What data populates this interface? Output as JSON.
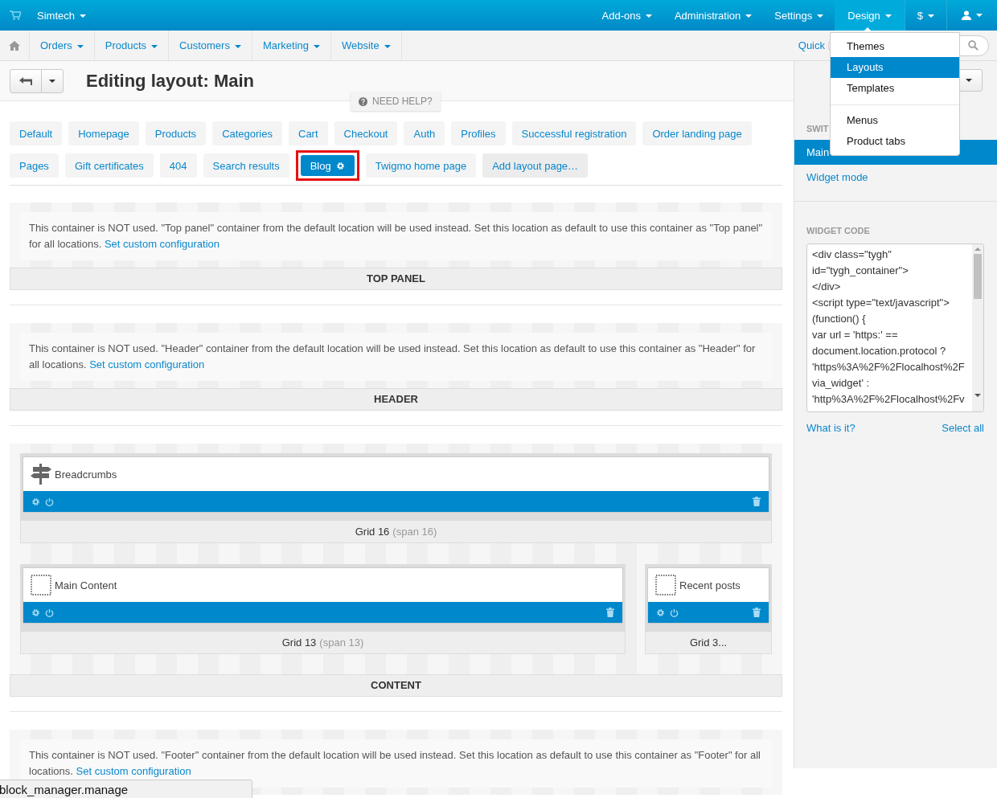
{
  "top_bar": {
    "store": "Simtech",
    "menus": [
      {
        "label": "Add-ons",
        "kind": "text",
        "selected": false
      },
      {
        "label": "Administration",
        "kind": "text",
        "selected": false
      },
      {
        "label": "Settings",
        "kind": "text",
        "selected": false
      },
      {
        "label": "Design",
        "kind": "text",
        "selected": true
      },
      {
        "label": "$",
        "kind": "boxed",
        "selected": false
      },
      {
        "kind": "user",
        "selected": false
      }
    ]
  },
  "nav": {
    "items": [
      "Orders",
      "Products",
      "Customers",
      "Marketing",
      "Website"
    ],
    "quick": "Quick"
  },
  "design_menu": {
    "groups": [
      [
        {
          "label": "Themes",
          "selected": false
        },
        {
          "label": "Layouts",
          "selected": true
        },
        {
          "label": "Templates",
          "selected": false
        }
      ],
      [
        {
          "label": "Menus",
          "selected": false
        },
        {
          "label": "Product tabs",
          "selected": false
        }
      ]
    ]
  },
  "header": {
    "title": "Editing layout: Main",
    "help": "NEED HELP?"
  },
  "layout_tabs": [
    [
      {
        "label": "Default",
        "kind": "page",
        "selected": false,
        "highlighted": false
      },
      {
        "label": "Homepage",
        "kind": "page",
        "selected": false,
        "highlighted": false
      },
      {
        "label": "Products",
        "kind": "page",
        "selected": false,
        "highlighted": false
      },
      {
        "label": "Categories",
        "kind": "page",
        "selected": false,
        "highlighted": false
      },
      {
        "label": "Cart",
        "kind": "page",
        "selected": false,
        "highlighted": false
      },
      {
        "label": "Checkout",
        "kind": "page",
        "selected": false,
        "highlighted": false
      },
      {
        "label": "Auth",
        "kind": "page",
        "selected": false,
        "highlighted": false
      },
      {
        "label": "Profiles",
        "kind": "page",
        "selected": false,
        "highlighted": false
      },
      {
        "label": "Successful registration",
        "kind": "page",
        "selected": false,
        "highlighted": false
      },
      {
        "label": "Order landing page",
        "kind": "page",
        "selected": false,
        "highlighted": false
      }
    ],
    [
      {
        "label": "Pages",
        "kind": "page",
        "selected": false,
        "highlighted": false
      },
      {
        "label": "Gift certificates",
        "kind": "page",
        "selected": false,
        "highlighted": false
      },
      {
        "label": "404",
        "kind": "page",
        "selected": false,
        "highlighted": false
      },
      {
        "label": "Search results",
        "kind": "page",
        "selected": false,
        "highlighted": false
      },
      {
        "label": "Blog",
        "kind": "page",
        "selected": true,
        "highlighted": true
      },
      {
        "label": "Twigmo home page",
        "kind": "page",
        "selected": false,
        "highlighted": false
      },
      {
        "label": "Add layout page…",
        "kind": "add",
        "selected": false,
        "highlighted": false
      }
    ]
  ],
  "containers": [
    {
      "title": "TOP PANEL",
      "used": false,
      "notice": "This container is NOT used. \"Top panel\" container from the default location will be used instead. Set this location as default to use this container as \"Top panel\" for all locations.",
      "link": "Set custom configuration"
    },
    {
      "title": "HEADER",
      "used": false,
      "notice": "This container is NOT used. \"Header\" container from the default location will be used instead. Set this location as default to use this container as \"Header\" for all locations.",
      "link": "Set custom configuration"
    },
    {
      "title": "CONTENT",
      "used": true,
      "grid_rows": [
        [
          {
            "title": "Grid 16",
            "span": "(span 16)",
            "blocks": [
              {
                "name": "Breadcrumbs",
                "kind": "signpost"
              }
            ]
          }
        ],
        [
          {
            "title": "Grid 13",
            "span": "(span 13)",
            "blocks": [
              {
                "name": "Main Content",
                "kind": "placeholder"
              }
            ]
          },
          {
            "title": "Grid 3...",
            "blocks": [
              {
                "name": "Recent posts",
                "kind": "placeholder"
              }
            ]
          }
        ]
      ]
    },
    {
      "used": false,
      "notice": "This container is NOT used. \"Footer\" container from the default location will be used instead. Set this location as default to use this container as \"Footer\" for all locations.",
      "link": "Set custom configuration"
    }
  ],
  "sidebar": {
    "switch_label": "SWIT",
    "items": [
      {
        "label": "Main",
        "selected": true
      },
      {
        "label": "Widget mode",
        "selected": false
      }
    ],
    "widget_code": {
      "title": "WIDGET CODE",
      "lines": [
        "<div class=\"tygh\"",
        "id=\"tygh_container\">",
        "</div>",
        "<script type=\"text/javascript\">",
        "(function() {",
        "var url = 'https:' ==",
        "document.location.protocol ?",
        "'https%3A%2F%2Flocalhost%2F",
        "via_widget' :",
        "'http%3A%2F%2Flocalhost%2Fv"
      ]
    },
    "links": [
      "What is it?",
      "Select all"
    ]
  },
  "status_tooltip": "block_manager.manage"
}
